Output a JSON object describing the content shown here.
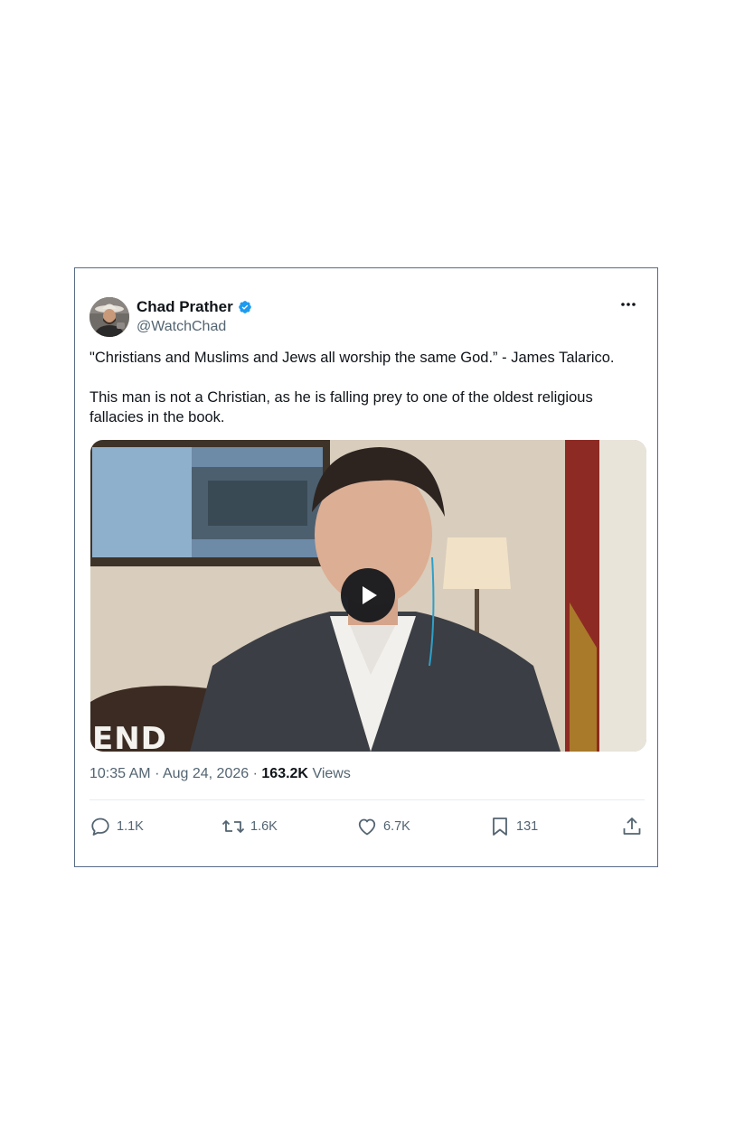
{
  "tweet": {
    "author": {
      "display_name": "Chad Prather",
      "handle": "@WatchChad",
      "verified": true
    },
    "text": [
      "\"Christians and Muslims and Jews all worship the same God.” - James Talarico.",
      "This man is not a Christian, as he is falling prey to one of the oldest religious fallacies in the book."
    ],
    "media": {
      "type": "video",
      "overlay_text": "END"
    },
    "timestamp": "10:35 AM",
    "date": "Aug 24, 2026",
    "separator": "·",
    "views_count": "163.2K",
    "views_label": "Views",
    "actions": {
      "replies": "1.1K",
      "reposts": "1.6K",
      "likes": "6.7K",
      "bookmarks": "131"
    }
  },
  "icons": {
    "verified": "verified-badge-icon",
    "more": "more-options-icon",
    "reply": "reply-icon",
    "repost": "repost-icon",
    "like": "heart-icon",
    "bookmark": "bookmark-icon",
    "share": "share-icon",
    "play": "play-icon"
  },
  "colors": {
    "verified_blue": "#1d9bf0",
    "text_primary": "#0f1419",
    "text_secondary": "#536471",
    "card_border": "#5a6b87"
  }
}
